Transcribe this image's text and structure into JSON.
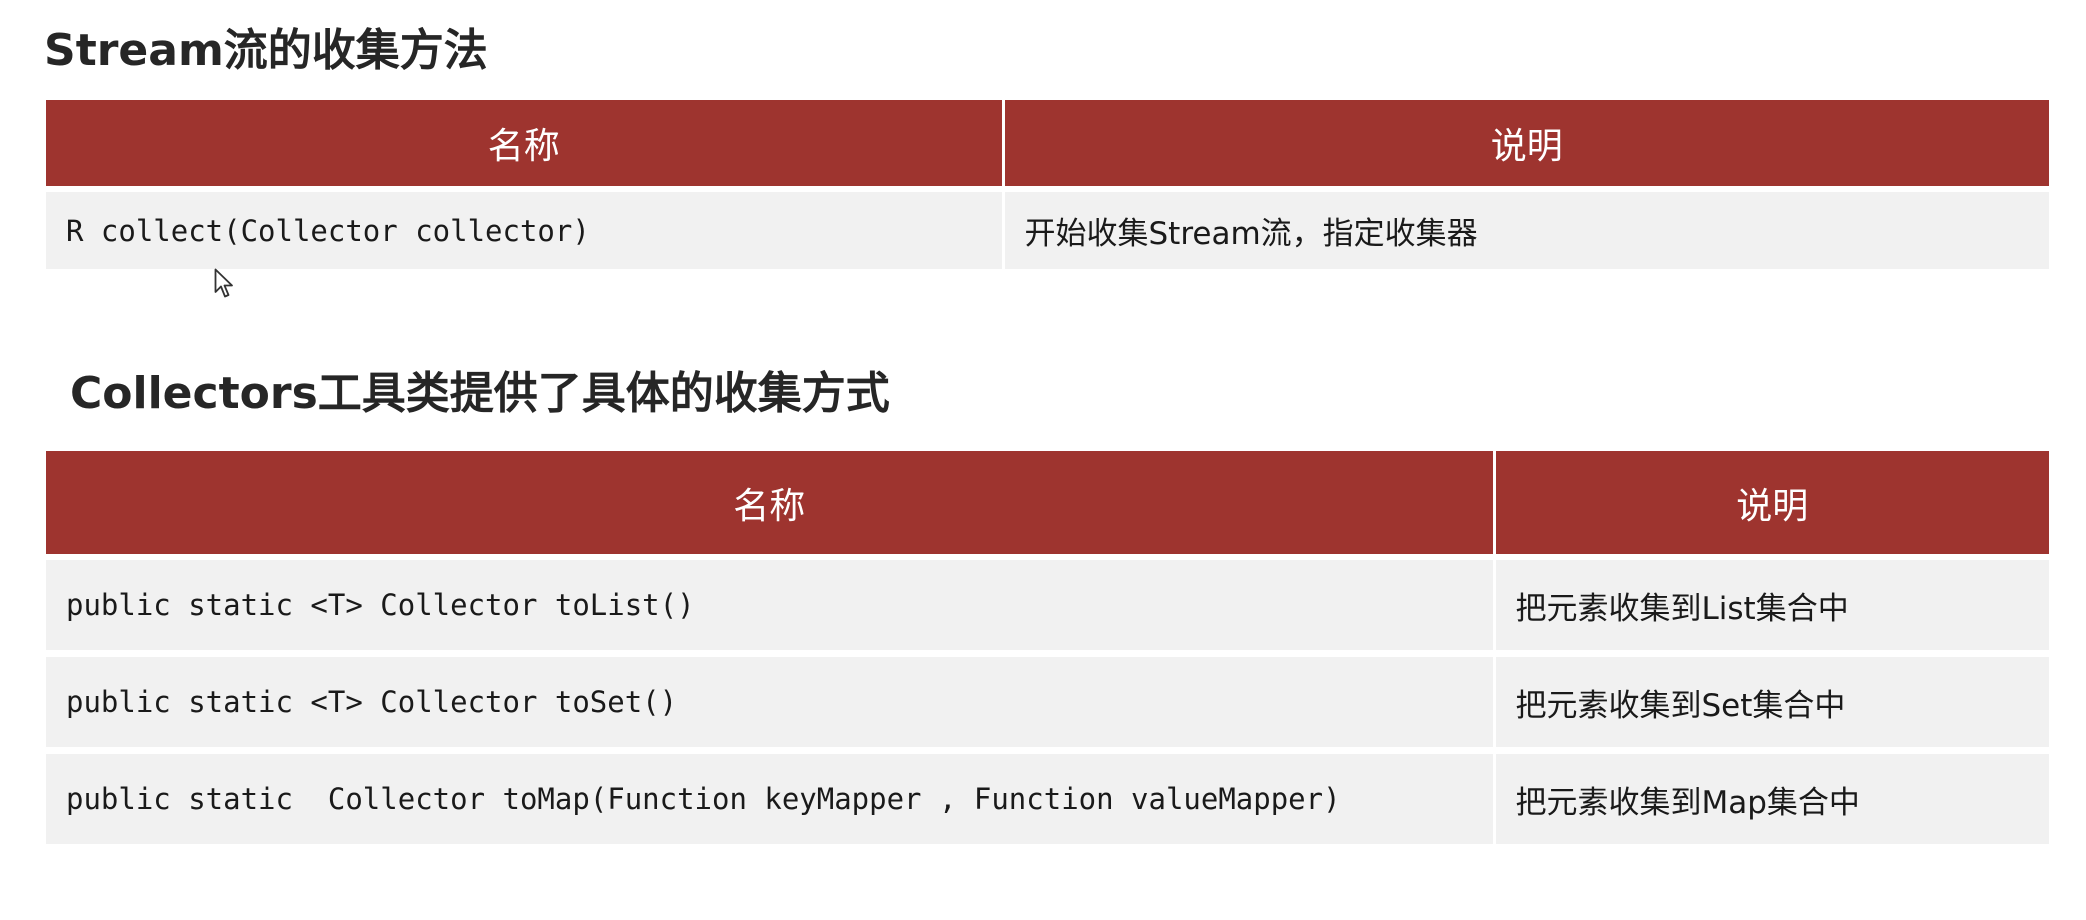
{
  "section1": {
    "title": "Stream流的收集方法",
    "headers": [
      "名称",
      "说明"
    ],
    "rows": [
      {
        "name": "R collect(Collector collector)",
        "description": "开始收集Stream流，指定收集器"
      }
    ]
  },
  "section2": {
    "title": "Collectors工具类提供了具体的收集方式",
    "headers": [
      "名称",
      "说明"
    ],
    "rows": [
      {
        "name": "public static <T> Collector toList()",
        "description": "把元素收集到List集合中"
      },
      {
        "name": "public static <T> Collector toSet()",
        "description": "把元素收集到Set集合中"
      },
      {
        "name": "public static  Collector toMap(Function keyMapper , Function valueMapper)",
        "description": "把元素收集到Map集合中"
      }
    ]
  },
  "icons": {
    "cursor": "mouse-pointer-icon"
  }
}
